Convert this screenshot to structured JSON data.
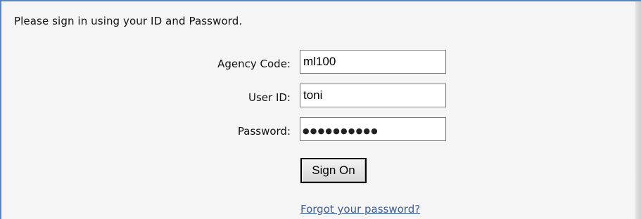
{
  "intro_text": "Please sign in using your ID and Password.",
  "form": {
    "agency_code": {
      "label": "Agency Code:",
      "value": "ml100"
    },
    "user_id": {
      "label": "User ID:",
      "value": "toni"
    },
    "password": {
      "label": "Password:",
      "masked_value": "●●●●●●●●●●"
    },
    "sign_on_label": "Sign On",
    "forgot_link": "Forgot your password?"
  },
  "colors": {
    "frame_border": "#5b86bd",
    "link": "#3b5f98",
    "background": "#f5f5f5"
  }
}
